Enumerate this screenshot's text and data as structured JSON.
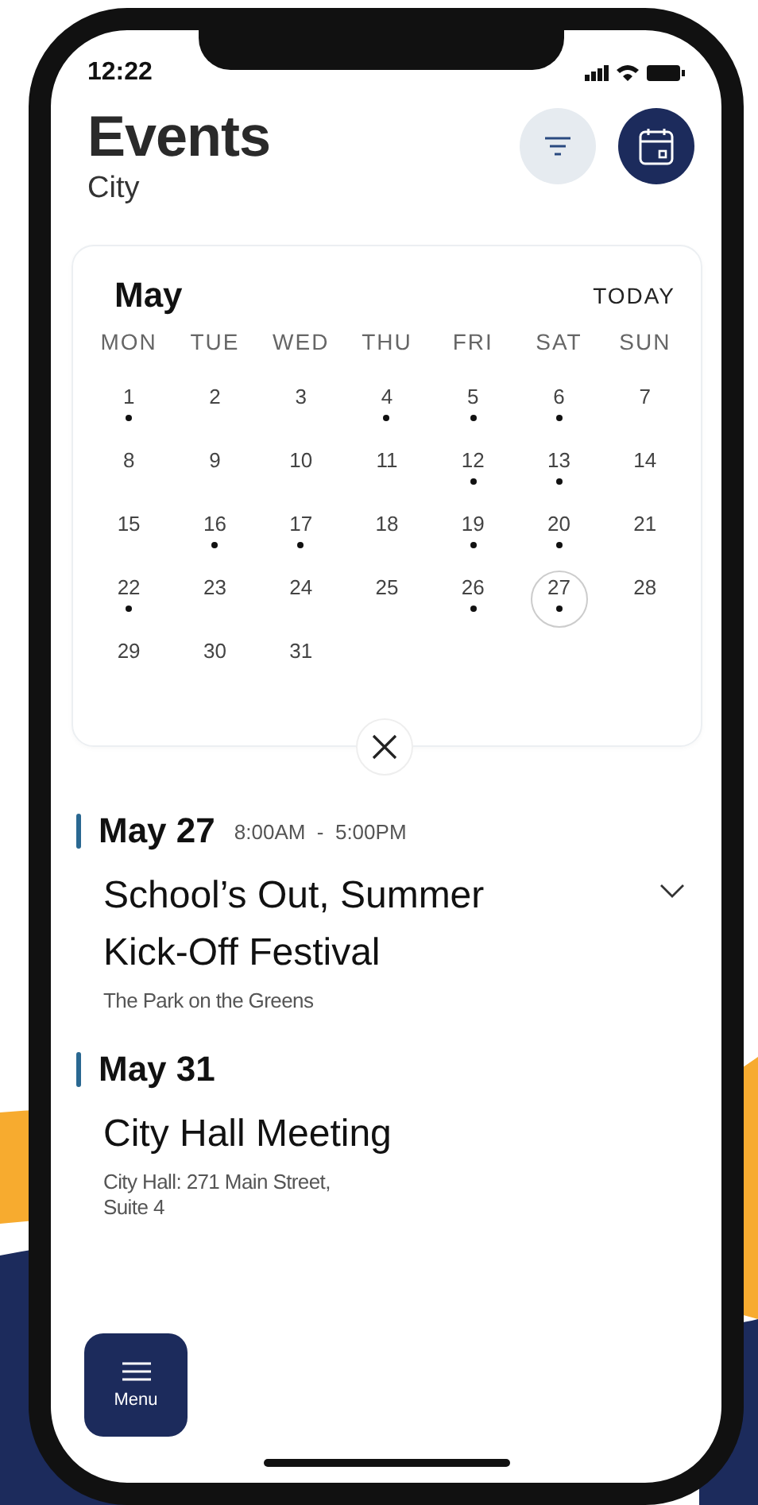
{
  "status_bar": {
    "time": "12:22"
  },
  "header": {
    "title": "Events",
    "subtitle": "City"
  },
  "calendar": {
    "month": "May",
    "today_label": "TODAY",
    "weekdays": [
      "MON",
      "TUE",
      "WED",
      "THU",
      "FRI",
      "SAT",
      "SUN"
    ],
    "days": [
      {
        "label": "1",
        "has_event": true,
        "selected": false
      },
      {
        "label": "2",
        "has_event": false,
        "selected": false
      },
      {
        "label": "3",
        "has_event": false,
        "selected": false
      },
      {
        "label": "4",
        "has_event": true,
        "selected": false
      },
      {
        "label": "5",
        "has_event": true,
        "selected": false
      },
      {
        "label": "6",
        "has_event": true,
        "selected": false
      },
      {
        "label": "7",
        "has_event": false,
        "selected": false
      },
      {
        "label": "8",
        "has_event": false,
        "selected": false
      },
      {
        "label": "9",
        "has_event": false,
        "selected": false
      },
      {
        "label": "10",
        "has_event": false,
        "selected": false
      },
      {
        "label": "11",
        "has_event": false,
        "selected": false
      },
      {
        "label": "12",
        "has_event": true,
        "selected": false
      },
      {
        "label": "13",
        "has_event": true,
        "selected": false
      },
      {
        "label": "14",
        "has_event": false,
        "selected": false
      },
      {
        "label": "15",
        "has_event": false,
        "selected": false
      },
      {
        "label": "16",
        "has_event": true,
        "selected": false
      },
      {
        "label": "17",
        "has_event": true,
        "selected": false
      },
      {
        "label": "18",
        "has_event": false,
        "selected": false
      },
      {
        "label": "19",
        "has_event": true,
        "selected": false
      },
      {
        "label": "20",
        "has_event": true,
        "selected": false
      },
      {
        "label": "21",
        "has_event": false,
        "selected": false
      },
      {
        "label": "22",
        "has_event": true,
        "selected": false
      },
      {
        "label": "23",
        "has_event": false,
        "selected": false
      },
      {
        "label": "24",
        "has_event": false,
        "selected": false
      },
      {
        "label": "25",
        "has_event": false,
        "selected": false
      },
      {
        "label": "26",
        "has_event": true,
        "selected": false
      },
      {
        "label": "27",
        "has_event": true,
        "selected": true
      },
      {
        "label": "28",
        "has_event": false,
        "selected": false
      },
      {
        "label": "29",
        "has_event": false,
        "selected": false
      },
      {
        "label": "30",
        "has_event": false,
        "selected": false
      },
      {
        "label": "31",
        "has_event": false,
        "selected": false
      }
    ]
  },
  "events": [
    {
      "date": "May 27",
      "time": "8:00AM  -  5:00PM",
      "title": "School’s Out, Summer Kick-Off Festival",
      "location": "The Park on the Greens",
      "expandable": true
    },
    {
      "date": "May 31",
      "title": "City Hall Meeting",
      "location": "City Hall: 271 Main Street, Suite 4",
      "expandable": false
    }
  ],
  "menu": {
    "label": "Menu"
  }
}
